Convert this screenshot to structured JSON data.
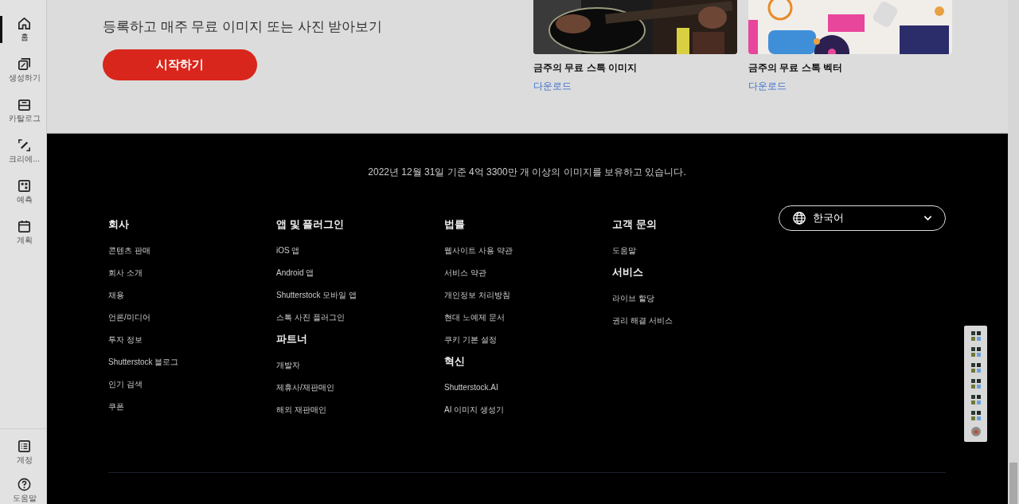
{
  "sidebar": {
    "items": [
      {
        "label": "홈",
        "kind": "home",
        "selected": true
      },
      {
        "label": "생성하기",
        "kind": "create",
        "selected": false
      },
      {
        "label": "카탈로그",
        "kind": "catalog",
        "selected": false
      },
      {
        "label": "크리에...",
        "kind": "pencil",
        "selected": false
      },
      {
        "label": "예측",
        "kind": "grid",
        "selected": false
      },
      {
        "label": "계획",
        "kind": "calendar",
        "selected": false
      }
    ],
    "bottom_items": [
      {
        "label": "계정",
        "kind": "list",
        "selected": false
      },
      {
        "label": "도움말",
        "kind": "help",
        "selected": false
      }
    ]
  },
  "hero": {
    "subtitle": "등록하고 매주 무료 이미지 또는 사진 받아보기",
    "button": "시작하기"
  },
  "cards": [
    {
      "title": "금주의 무료 스톡 이미지",
      "link": "다운로드"
    },
    {
      "kind": "vector",
      "title": "금주의 무료 스톡 벡터",
      "link": "다운로드"
    }
  ],
  "footer": {
    "stat": "2022년 12월 31일 기준 4억 3300만 개 이상의 이미지를 보유하고 있습니다.",
    "columns": [
      {
        "sections": [
          {
            "heading": "회사",
            "links": [
              "콘텐츠 판매",
              "회사 소개",
              "채용",
              "언론/미디어",
              "투자 정보",
              "Shutterstock 블로그",
              "인기 검색",
              "쿠폰"
            ]
          }
        ]
      },
      {
        "sections": [
          {
            "heading": "앱 및 플러그인",
            "links": [
              "iOS 앱",
              "Android 앱",
              "Shutterstock 모바일 앱",
              "스톡 사진 플러그인"
            ]
          },
          {
            "heading": "파트너",
            "links": [
              "개발자",
              "제휴사/재판매인",
              "해외 재판매인"
            ]
          }
        ]
      },
      {
        "sections": [
          {
            "heading": "법률",
            "links": [
              "웹사이트 사용 약관",
              "서비스 약관",
              "개인정보 처리방침",
              "현대 노예제 문서",
              "쿠키 기본 설정"
            ]
          },
          {
            "heading": "혁신",
            "links": [
              "Shutterstock.AI",
              "AI 이미지 생성기"
            ]
          }
        ]
      },
      {
        "sections": [
          {
            "heading": "고객 문의",
            "links": [
              "도움말"
            ]
          },
          {
            "heading": "서비스",
            "links": [
              "라이브 할당",
              "권리 해결 서비스"
            ]
          }
        ]
      }
    ],
    "language": "한국어"
  }
}
